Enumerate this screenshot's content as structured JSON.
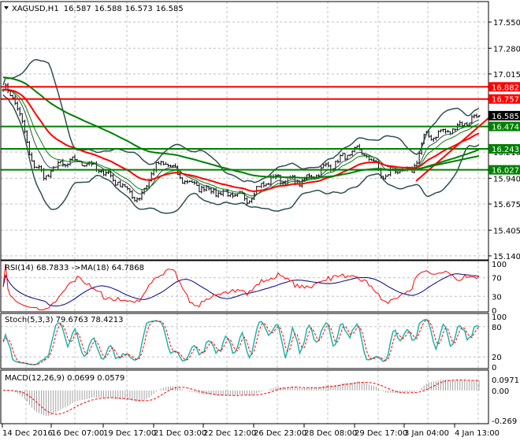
{
  "header": {
    "symbol": "XAGUSD,H1",
    "open": "16.587",
    "high": "16.588",
    "low": "16.573",
    "close": "16.585"
  },
  "price_axis": [
    "17.550",
    "17.280",
    "17.015",
    "16.210",
    "15.940",
    "15.675",
    "15.405",
    "15.140"
  ],
  "price_levels": [
    {
      "label": "16.882",
      "value": 16.882,
      "color": "#ff0000"
    },
    {
      "label": "16.757",
      "value": 16.757,
      "color": "#ff0000"
    },
    {
      "label": "16.474",
      "value": 16.474,
      "color": "#008000"
    },
    {
      "label": "16.243",
      "value": 16.243,
      "color": "#008000"
    },
    {
      "label": "16.027",
      "value": 16.027,
      "color": "#008000"
    }
  ],
  "current_price": {
    "label": "16.585",
    "value": 16.585
  },
  "rsi": {
    "title": "RSI(14) 68.7833  ->MA(18) 64.7868",
    "axis": [
      "100",
      "70",
      "30",
      "0"
    ]
  },
  "stoch": {
    "title": "Stoch(5,3,3) 79.6763 78.4213",
    "axis": [
      "100",
      "80",
      "20",
      "0"
    ]
  },
  "macd": {
    "title": "MACD(12,26,9) 0.0699 0.0579",
    "axis": [
      "0.0971",
      "0.00",
      "-0.269"
    ]
  },
  "time_axis": [
    "14 Dec 2016",
    "16 Dec 07:00",
    "19 Dec 17:00",
    "21 Dec 03:00",
    "22 Dec 12:00",
    "26 Dec 23:00",
    "28 Dec 08:00",
    "29 Dec 17:00",
    "3 Jan 04:00",
    "4 Jan 13:00"
  ],
  "price_path": [
    16.88,
    16.72,
    16.15,
    15.95,
    16.07,
    16.11,
    16.11,
    16.03,
    15.95,
    15.83,
    15.71,
    16.03,
    16.11,
    15.95,
    15.87,
    15.83,
    15.79,
    15.76,
    15.73,
    15.87,
    15.95,
    15.91,
    15.91,
    15.99,
    16.07,
    16.15,
    16.23,
    16.15,
    15.95,
    16.03,
    15.99,
    16.36,
    16.4,
    16.44,
    16.52,
    16.585
  ],
  "colors": {
    "up_line": "#ff0000",
    "support": "#008000",
    "ma_red": "#ff0000",
    "ma_green": "#008000",
    "bands": "#2f4f4f",
    "rsi": "#ff0000",
    "rsi_ma": "#000080",
    "stoch_main": "#20b2aa",
    "stoch_signal": "#ff0000"
  }
}
